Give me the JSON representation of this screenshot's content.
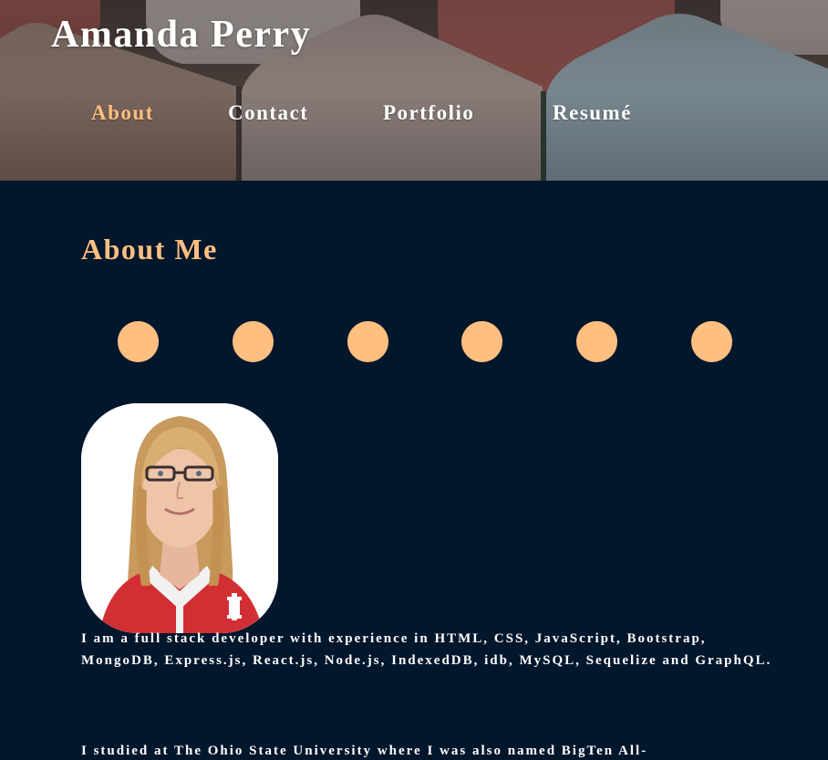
{
  "header": {
    "site_title": "Amanda Perry",
    "background": "stone-roof-tiles-photo",
    "nav": [
      {
        "label": "About",
        "active": true
      },
      {
        "label": "Contact",
        "active": false
      },
      {
        "label": "Portfolio",
        "active": false
      },
      {
        "label": "Resumé",
        "active": false
      }
    ]
  },
  "main": {
    "section_title": "About Me",
    "social_links": [
      {
        "icon": "social-link-icon-1"
      },
      {
        "icon": "social-link-icon-2"
      },
      {
        "icon": "social-link-icon-3"
      },
      {
        "icon": "social-link-icon-4"
      },
      {
        "icon": "social-link-icon-5"
      },
      {
        "icon": "social-link-icon-6"
      }
    ],
    "profile_photo": "profile-photo",
    "bio": [
      "I am a full stack developer with experience in HTML, CSS, JavaScript, Bootstrap, MongoDB, Express.js, React.js, Node.js, IndexedDB, idb, MySQL, Sequelize and GraphQL.",
      "I studied at The Ohio State University where I was also named BigTen All-"
    ]
  },
  "colors": {
    "background": "#02162c",
    "accent": "#ffbf80",
    "text": "#ffffff"
  }
}
